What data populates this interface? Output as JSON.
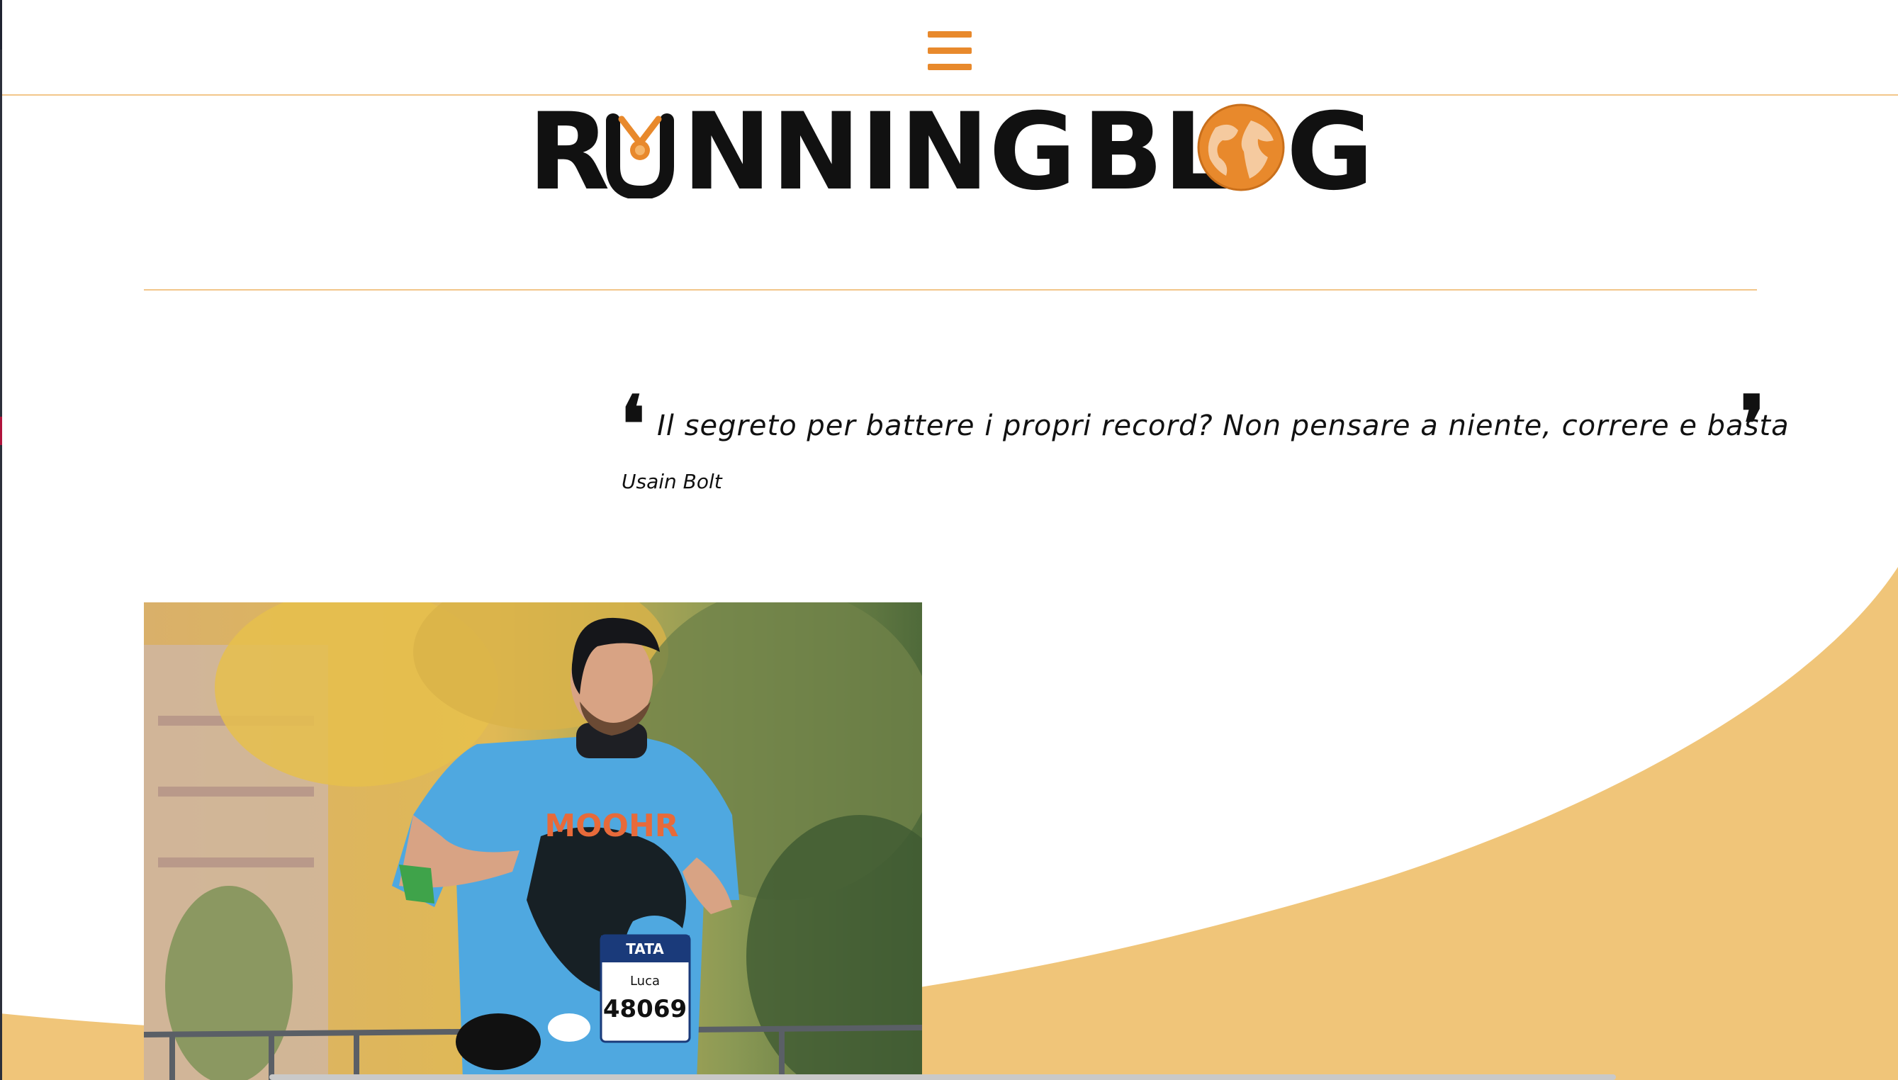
{
  "header": {
    "menu_icon": "hamburger-menu-icon"
  },
  "logo": {
    "part1": "R",
    "part2": "NNING",
    "part3": "BL",
    "part4": "G",
    "medal_icon": "medal-icon",
    "globe_icon": "globe-icon"
  },
  "quote": {
    "text": "Il segreto per battere i propri record? Non pensare a niente, correre e basta",
    "author": "Usain Bolt"
  },
  "photo": {
    "bib_name": "Luca",
    "bib_number": "48069",
    "shirt_text": "MOOHR",
    "sponsor": "TATA"
  },
  "colors": {
    "accent": "#e8892c",
    "wave": "#f0c579",
    "divider": "#f2c68a",
    "text": "#111111"
  }
}
